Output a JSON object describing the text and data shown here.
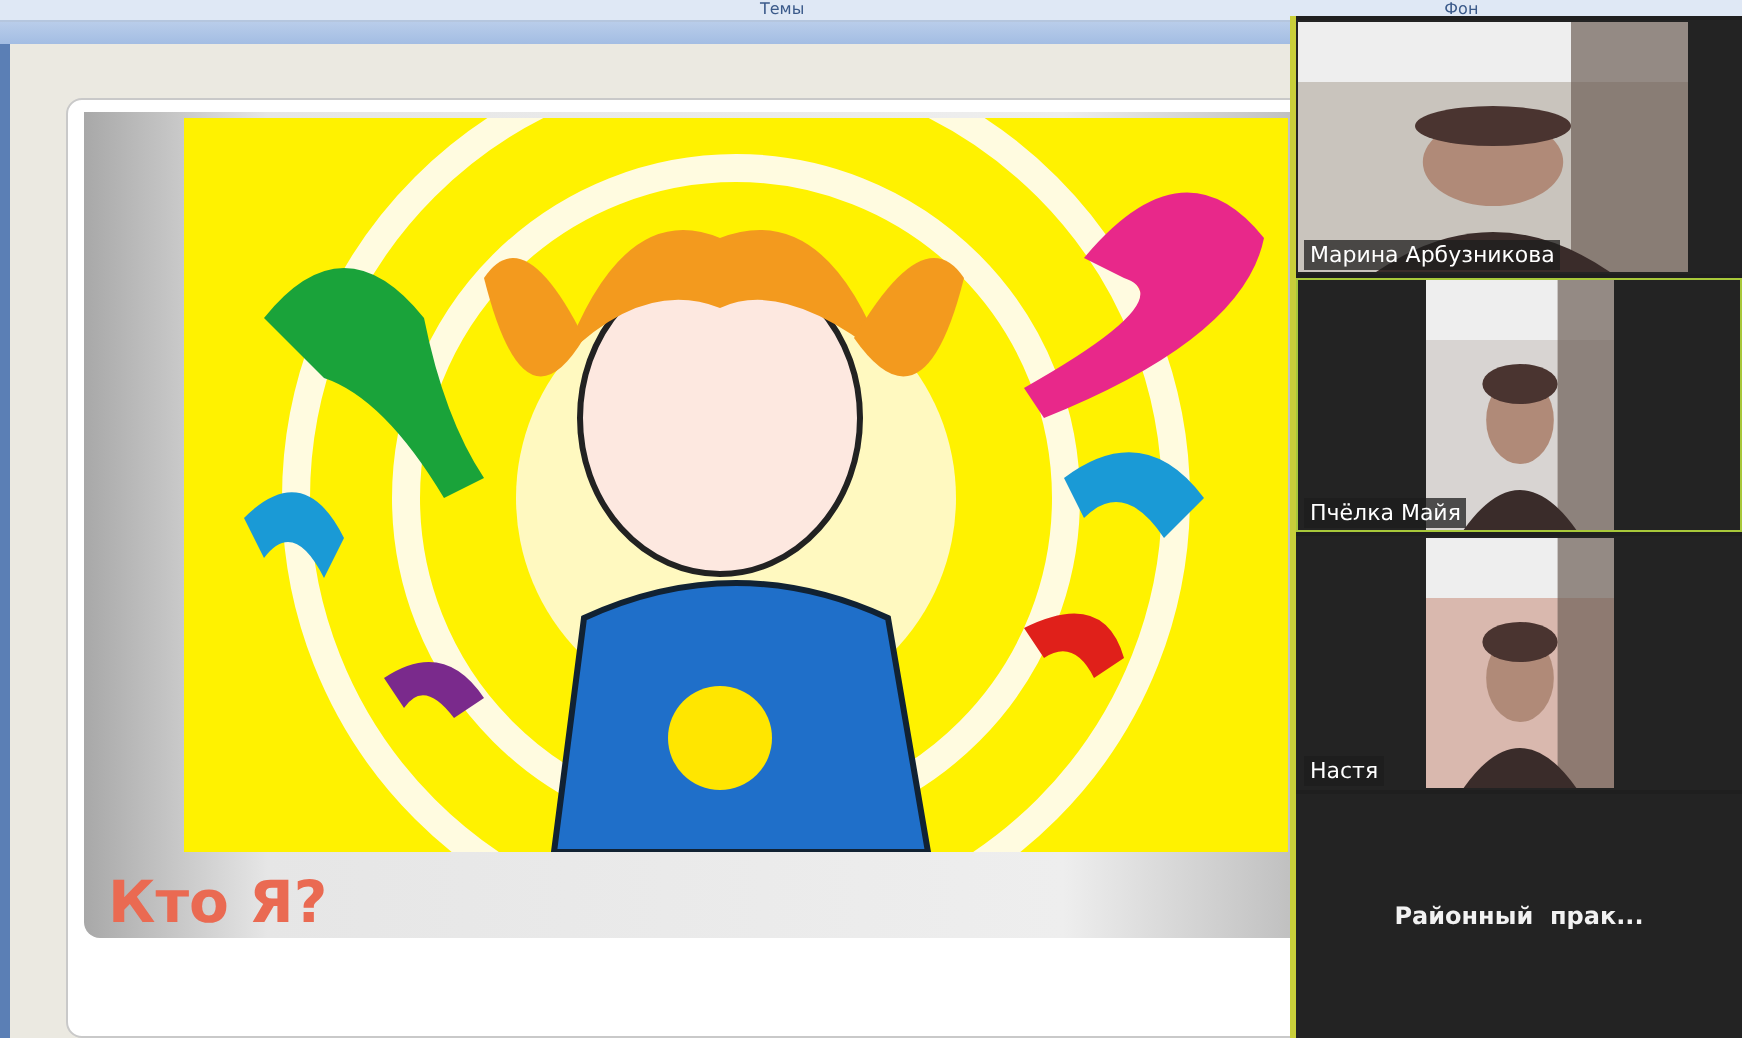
{
  "ribbon": {
    "groups": [
      {
        "label": "Темы"
      },
      {
        "label": "Фон"
      }
    ]
  },
  "slide": {
    "title": "Кто Я?"
  },
  "participants": [
    {
      "name": "Марина Арбузникова",
      "kind": "video",
      "selected": false
    },
    {
      "name": "Пчёлка Майя",
      "kind": "video",
      "selected": true
    },
    {
      "name": "Настя",
      "kind": "video",
      "selected": false
    },
    {
      "name": "Районный  прак...",
      "kind": "name_only",
      "selected": false
    }
  ]
}
